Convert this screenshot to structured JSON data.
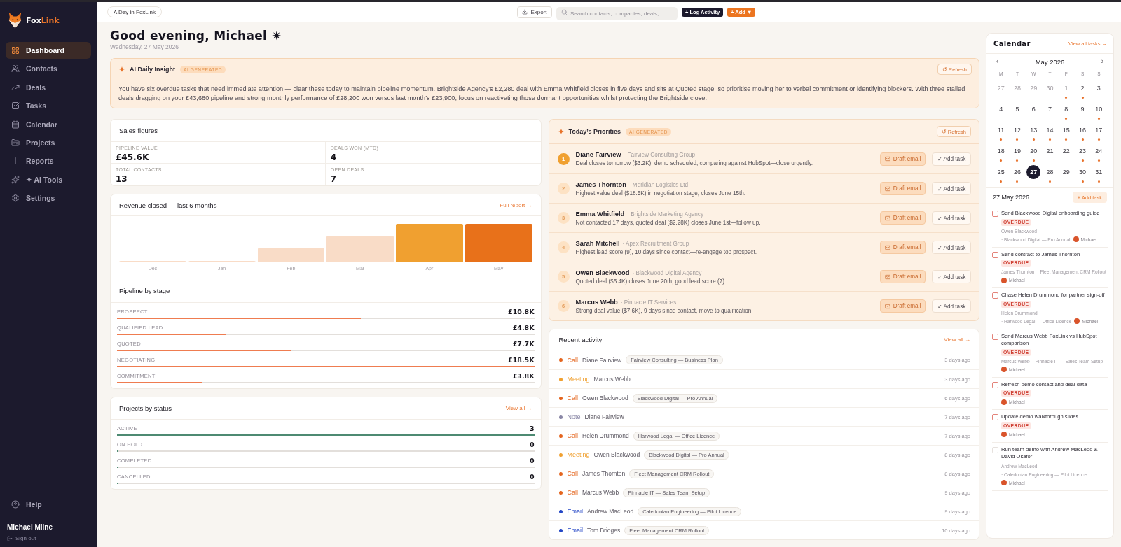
{
  "sidebar": {
    "brand": {
      "first": "Fox",
      "second": "Link"
    },
    "items": [
      {
        "label": "Dashboard",
        "selected": true
      },
      {
        "label": "Contacts",
        "selected": false
      },
      {
        "label": "Deals",
        "selected": false
      },
      {
        "label": "Tasks",
        "selected": false
      },
      {
        "label": "Calendar",
        "selected": false
      },
      {
        "label": "Projects",
        "selected": false
      },
      {
        "label": "Reports",
        "selected": false
      },
      {
        "label": "✦ AI Tools",
        "selected": false
      },
      {
        "label": "Settings",
        "selected": false
      }
    ],
    "help": "Help",
    "user": {
      "name": "Michael Milne",
      "sign_out": "Sign out"
    }
  },
  "topbar": {
    "context_button": "A Day in FoxLink",
    "export_button": "Export",
    "search": {
      "placeholder": "Search contacts, companies, deals,"
    },
    "log_button": "+ Log Activity",
    "add_button": "+ Add ▼"
  },
  "greeting": {
    "title": "Good evening, Michael ✷",
    "date": "Wednesday, 27 May 2026"
  },
  "insight": {
    "title": "AI Daily Insight",
    "badge": "AI GENERATED",
    "refresh": "↺ Refresh",
    "text": "You have six overdue tasks that need immediate attention — clear these today to maintain pipeline momentum. Brightside Agency’s £2,280 deal with Emma Whitfield closes in five days and sits at Quoted stage, so prioritise moving her to verbal commitment or identifying blockers. With three stalled deals dragging on your £43,680 pipeline and strong monthly performance of £28,200 won versus last month’s £23,900, focus on reactivating those dormant opportunities whilst protecting the Brightside close."
  },
  "sales": {
    "title": "Sales figures",
    "stats": [
      {
        "label": "PIPELINE VALUE",
        "value": "£45.6K"
      },
      {
        "label": "DEALS WON (MTD)",
        "value": "4"
      },
      {
        "label": "TOTAL CONTACTS",
        "value": "13"
      },
      {
        "label": "OPEN DEALS",
        "value": "7"
      }
    ]
  },
  "revenue": {
    "title": "Revenue closed — last 6 months",
    "link": "Full report →",
    "months": [
      "Dec",
      "Jan",
      "Feb",
      "Mar",
      "Apr",
      "May"
    ]
  },
  "pipeline": {
    "title": "Pipeline by stage",
    "stages": [
      {
        "label": "PROSPECT",
        "value": "£10.8K",
        "level": 0.584
      },
      {
        "label": "QUALIFIED LEAD",
        "value": "£4.8K",
        "level": 0.26
      },
      {
        "label": "QUOTED",
        "value": "£7.7K",
        "level": 0.416
      },
      {
        "label": "NEGOTIATING",
        "value": "£18.5K",
        "level": 1
      },
      {
        "label": "COMMITMENT",
        "value": "£3.8K",
        "level": 0.205
      }
    ]
  },
  "projects": {
    "title": "Projects by status",
    "link": "View all →",
    "statuses": [
      {
        "label": "ACTIVE",
        "value": "3",
        "level": 1
      },
      {
        "label": "ON HOLD",
        "value": "0",
        "level": 0
      },
      {
        "label": "COMPLETED",
        "value": "0",
        "level": 0
      },
      {
        "label": "CANCELLED",
        "value": "0",
        "level": 0
      }
    ]
  },
  "priorities": {
    "title": "Today’s Priorities",
    "badge": "AI GENERATED",
    "refresh": "↺ Refresh",
    "items": [
      {
        "rank": "1",
        "highlighted": true,
        "name": "Diane Fairview",
        "company": "· Fairview Consulting Group",
        "note": "Deal closes tomorrow ($3.2K), demo scheduled, comparing against HubSpot—close urgently.",
        "email_button": "Draft email",
        "task_button": "✓ Add task"
      },
      {
        "rank": "2",
        "highlighted": false,
        "name": "James Thornton",
        "company": "· Meridian Logistics Ltd",
        "note": "Highest value deal ($18.5K) in negotiation stage, closes June 15th.",
        "email_button": "Draft email",
        "task_button": "✓ Add task"
      },
      {
        "rank": "3",
        "highlighted": false,
        "name": "Emma Whitfield",
        "company": "· Brightside Marketing Agency",
        "note": "Not contacted 17 days, quoted deal ($2.28K) closes June 1st—follow up.",
        "email_button": "Draft email",
        "task_button": "✓ Add task"
      },
      {
        "rank": "4",
        "highlighted": false,
        "name": "Sarah Mitchell",
        "company": "· Apex Recruitment Group",
        "note": "Highest lead score (9), 10 days since contact—re-engage top prospect.",
        "email_button": "Draft email",
        "task_button": "✓ Add task"
      },
      {
        "rank": "5",
        "highlighted": false,
        "name": "Owen Blackwood",
        "company": "· Blackwood Digital Agency",
        "note": "Quoted deal ($5.4K) closes June 20th, good lead score (7).",
        "email_button": "Draft email",
        "task_button": "✓ Add task"
      },
      {
        "rank": "6",
        "highlighted": false,
        "name": "Marcus Webb",
        "company": "· Pinnacle IT Services",
        "note": "Strong deal value ($7.6K), 9 days since contact, move to qualification.",
        "email_button": "Draft email",
        "task_button": "✓ Add task"
      }
    ]
  },
  "activity": {
    "title": "Recent activity",
    "link": "View all →",
    "items": [
      {
        "type": "Call",
        "color": "#e4651e",
        "name": "Diane Fairview",
        "tag": "Fairview Consulting — Business Plan",
        "time": "3 days ago"
      },
      {
        "type": "Meeting",
        "color": "#f0a030",
        "name": "Marcus Webb",
        "time": "3 days ago"
      },
      {
        "type": "Call",
        "color": "#e4651e",
        "name": "Owen Blackwood",
        "tag": "Blackwood Digital — Pro Annual",
        "time": "6 days ago"
      },
      {
        "type": "Note",
        "color": "#8a87a6",
        "name": "Diane Fairview",
        "time": "7 days ago"
      },
      {
        "type": "Call",
        "color": "#e4651e",
        "name": "Helen Drummond",
        "tag": "Harwood Legal — Office Licence",
        "time": "7 days ago"
      },
      {
        "type": "Meeting",
        "color": "#f0a030",
        "name": "Owen Blackwood",
        "tag": "Blackwood Digital — Pro Annual",
        "time": "8 days ago"
      },
      {
        "type": "Call",
        "color": "#e4651e",
        "name": "James Thornton",
        "tag": "Fleet Management CRM Rollout",
        "time": "8 days ago"
      },
      {
        "type": "Call",
        "color": "#e4651e",
        "name": "Marcus Webb",
        "tag": "Pinnacle IT — Sales Team Setup",
        "time": "9 days ago"
      },
      {
        "type": "Email",
        "color": "#2447c6",
        "name": "Andrew MacLeod",
        "tag": "Caledonian Engineering — Pilot Licence",
        "time": "9 days ago"
      },
      {
        "type": "Email",
        "color": "#2447c6",
        "name": "Tom Bridges",
        "tag": "Fleet Management CRM Rollout",
        "time": "10 days ago"
      }
    ]
  },
  "calendar": {
    "title": "Calendar",
    "link": "View all tasks →",
    "month": "May 2026",
    "prev": "‹",
    "next": "›",
    "weekdays": [
      "M",
      "T",
      "W",
      "T",
      "F",
      "S",
      "S"
    ],
    "days": [
      {
        "label": "27",
        "outside": true,
        "has_events": false,
        "selected": false
      },
      {
        "label": "28",
        "outside": true,
        "has_events": false,
        "selected": false
      },
      {
        "label": "29",
        "outside": true,
        "has_events": false,
        "selected": false
      },
      {
        "label": "30",
        "outside": true,
        "has_events": false,
        "selected": false
      },
      {
        "label": "1",
        "outside": false,
        "has_events": true,
        "selected": false
      },
      {
        "label": "2",
        "outside": false,
        "has_events": true,
        "selected": false
      },
      {
        "label": "3",
        "outside": false,
        "has_events": false,
        "selected": false
      },
      {
        "label": "4",
        "outside": false,
        "has_events": false,
        "selected": false
      },
      {
        "label": "5",
        "outside": false,
        "has_events": false,
        "selected": false
      },
      {
        "label": "6",
        "outside": false,
        "has_events": false,
        "selected": false
      },
      {
        "label": "7",
        "outside": false,
        "has_events": false,
        "selected": false
      },
      {
        "label": "8",
        "outside": false,
        "has_events": true,
        "selected": false
      },
      {
        "label": "9",
        "outside": false,
        "has_events": false,
        "selected": false
      },
      {
        "label": "10",
        "outside": false,
        "has_events": true,
        "selected": false
      },
      {
        "label": "11",
        "outside": false,
        "has_events": true,
        "selected": false
      },
      {
        "label": "12",
        "outside": false,
        "has_events": true,
        "selected": false
      },
      {
        "label": "13",
        "outside": false,
        "has_events": true,
        "selected": false
      },
      {
        "label": "14",
        "outside": false,
        "has_events": true,
        "selected": false
      },
      {
        "label": "15",
        "outside": false,
        "has_events": true,
        "selected": false
      },
      {
        "label": "16",
        "outside": false,
        "has_events": true,
        "selected": false
      },
      {
        "label": "17",
        "outside": false,
        "has_events": true,
        "selected": false
      },
      {
        "label": "18",
        "outside": false,
        "has_events": true,
        "selected": false
      },
      {
        "label": "19",
        "outside": false,
        "has_events": true,
        "selected": false
      },
      {
        "label": "20",
        "outside": false,
        "has_events": true,
        "selected": false
      },
      {
        "label": "21",
        "outside": false,
        "has_events": false,
        "selected": false
      },
      {
        "label": "22",
        "outside": false,
        "has_events": false,
        "selected": false
      },
      {
        "label": "23",
        "outside": false,
        "has_events": true,
        "selected": false
      },
      {
        "label": "24",
        "outside": false,
        "has_events": true,
        "selected": false
      },
      {
        "label": "25",
        "outside": false,
        "has_events": true,
        "selected": false
      },
      {
        "label": "26",
        "outside": false,
        "has_events": true,
        "selected": false
      },
      {
        "label": "27",
        "outside": false,
        "has_events": false,
        "selected": true
      },
      {
        "label": "28",
        "outside": false,
        "has_events": true,
        "selected": false
      },
      {
        "label": "29",
        "outside": false,
        "has_events": false,
        "selected": false
      },
      {
        "label": "30",
        "outside": false,
        "has_events": true,
        "selected": false
      },
      {
        "label": "31",
        "outside": false,
        "has_events": true,
        "selected": false
      }
    ],
    "selected_date": "27 May 2026",
    "add_task": "+ Add task",
    "tasks": [
      {
        "title": "Send Blackwood Digital onboarding guide",
        "checked": false,
        "overdue": true,
        "badge": "OVERDUE",
        "contact": "Owen Blackwood",
        "deal": "· Blackwood Digital — Pro Annual",
        "assignee": "Michael"
      },
      {
        "title": "Send contract to James Thornton",
        "checked": false,
        "overdue": true,
        "badge": "OVERDUE",
        "contact": "James Thornton",
        "deal": "· Fleet Management CRM Rollout",
        "assignee": "Michael"
      },
      {
        "title": "Chase Helen Drummond for partner sign-off",
        "checked": false,
        "overdue": true,
        "badge": "OVERDUE",
        "contact": "Helen Drummond",
        "deal": "· Harwood Legal — Office Licence",
        "assignee": "Michael"
      },
      {
        "title": "Send Marcus Webb FoxLink vs HubSpot comparison",
        "checked": false,
        "overdue": true,
        "badge": "OVERDUE",
        "contact": "Marcus Webb",
        "deal": "· Pinnacle IT — Sales Team Setup",
        "assignee": "Michael"
      },
      {
        "title": "Refresh demo contact and deal data",
        "checked": false,
        "overdue": true,
        "badge": "OVERDUE",
        "assignee": "Michael"
      },
      {
        "title": "Update demo walkthrough slides",
        "checked": false,
        "overdue": true,
        "badge": "OVERDUE",
        "assignee": "Michael"
      },
      {
        "title": "Run team demo with Andrew MacLeod & David Okafor",
        "checked": false,
        "overdue": false,
        "contact": "Andrew MacLeod",
        "deal": "· Caledonian Engineering — Pilot Licence",
        "assignee": "Michael"
      }
    ]
  }
}
